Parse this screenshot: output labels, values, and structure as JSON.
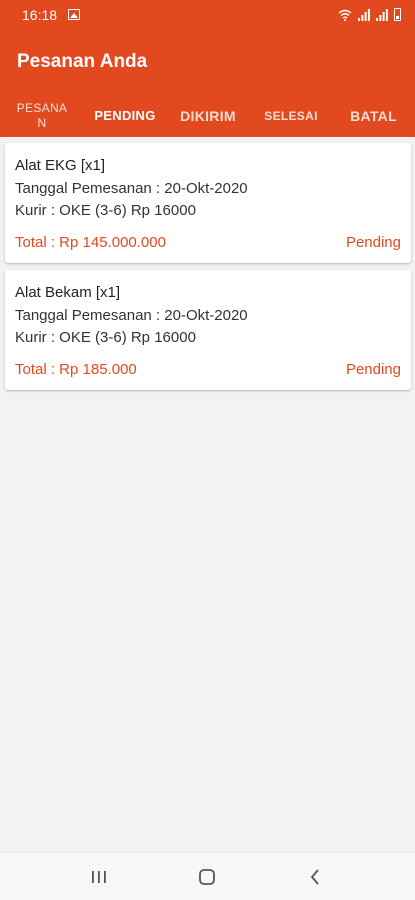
{
  "status_bar": {
    "time": "16:18",
    "icons": [
      "image-icon",
      "wifi-icon",
      "signal-icon",
      "signal-icon",
      "battery-icon"
    ]
  },
  "app_bar": {
    "title": "Pesanan Anda",
    "background": "#e2491f"
  },
  "tabs": [
    {
      "label": "PESANA\nN",
      "active": false
    },
    {
      "label": "PENDING",
      "active": true
    },
    {
      "label": "DIKIRIM",
      "active": false
    },
    {
      "label": "SELESAI",
      "active": false
    },
    {
      "label": "BATAL",
      "active": false
    }
  ],
  "orders": [
    {
      "name": "Alat EKG [x1]",
      "date": "Tanggal Pemesanan : 20-Okt-2020",
      "courier": "Kurir : OKE (3-6) Rp 16000",
      "total": "Total : Rp 145.000.000",
      "status": "Pending"
    },
    {
      "name": "Alat Bekam [x1]",
      "date": "Tanggal Pemesanan : 20-Okt-2020",
      "courier": "Kurir : OKE (3-6) Rp 16000",
      "total": "Total : Rp 185.000",
      "status": "Pending"
    }
  ],
  "accent_color": "#e2491f",
  "nav_bar": {
    "buttons": [
      "recent-apps-icon",
      "home-icon",
      "back-icon"
    ]
  }
}
